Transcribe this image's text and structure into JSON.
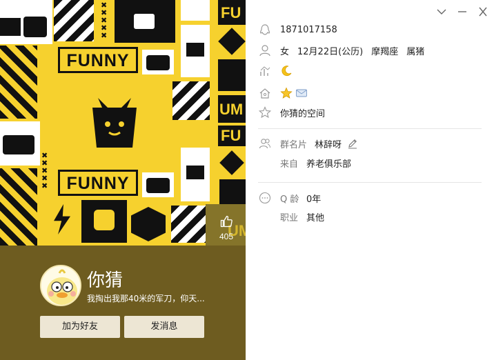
{
  "window": {
    "minimize_label": "─",
    "close_label": "✕"
  },
  "cover": {
    "banner_text": "FUNNY",
    "side_text_1": "FU",
    "side_text_2": "UM",
    "side_text_3": "FU",
    "side_text_4": "UM",
    "like_count": "405"
  },
  "profile": {
    "nickname": "你猜",
    "signature": "我掏出我那40米的军刀，仰天...",
    "add_friend_label": "加为好友",
    "send_message_label": "发消息"
  },
  "details": {
    "qq_number": "1871017158",
    "gender": "女",
    "birthday": "12月22日(公历)",
    "zodiac": "摩羯座",
    "chinese_zodiac": "属猪",
    "qzone_label": "你猜的空间",
    "group_card_label": "群名片",
    "group_card_value": "林辞呀",
    "from_label": "来自",
    "from_value": "养老俱乐部",
    "q_age_label": "Q 龄",
    "q_age_value": "0年",
    "job_label": "职业",
    "job_value": "其他"
  }
}
